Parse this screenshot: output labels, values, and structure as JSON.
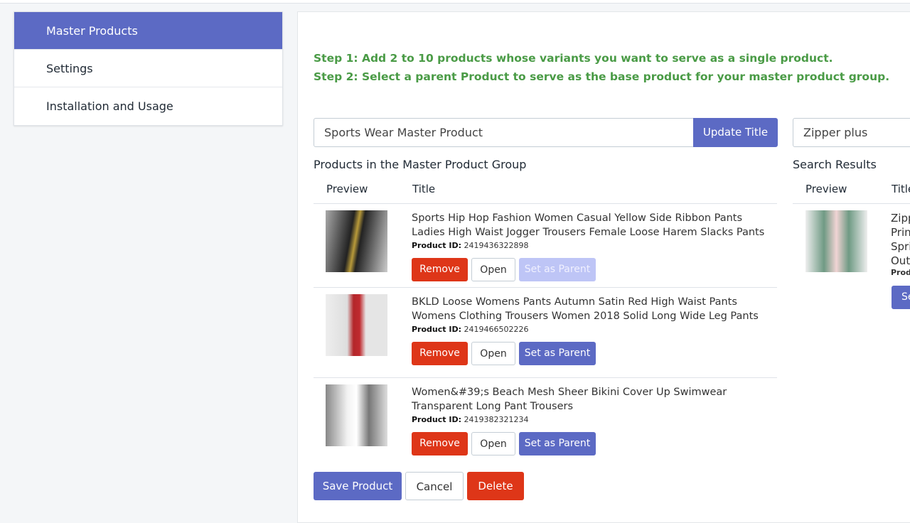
{
  "sidebar": {
    "items": [
      {
        "label": "Master Products",
        "active": true
      },
      {
        "label": "Settings"
      },
      {
        "label": "Installation and Usage"
      }
    ]
  },
  "steps": [
    "Step 1: Add 2 to 10 products whose variants you want to serve as a single product.",
    "Step 2: Select a parent Product to serve as the base product for your master product group."
  ],
  "title_input": {
    "value": "Sports Wear Master Product"
  },
  "update_title_label": "Update Title",
  "search_input": {
    "value": "Zipper plus"
  },
  "group": {
    "heading": "Products in the Master Product Group",
    "columns": [
      "Preview",
      "Title"
    ],
    "product_id_label": "Product ID:",
    "rows": [
      {
        "title": "Sports Hip Hop Fashion Women Casual Yellow Side Ribbon Pants Ladies High Waist Jogger Trousers Female Loose Harem Slacks Pants",
        "id": "2419436322898",
        "parent_disabled": true
      },
      {
        "title": "BKLD Loose Womens Pants Autumn Satin Red High Waist Pants Womens Clothing Trousers Women 2018 Solid Long Wide Leg Pants",
        "id": "2419466502226",
        "parent_disabled": false
      },
      {
        "title": "Women&#39;s Beach Mesh Sheer Bikini Cover Up Swimwear Transparent Long Pant Trousers",
        "id": "2419382321234",
        "parent_disabled": false
      }
    ],
    "remove_label": "Remove",
    "open_label": "Open",
    "parent_label": "Set as Parent"
  },
  "search_results": {
    "heading": "Search Results",
    "columns": [
      "Preview",
      "Title"
    ],
    "row": {
      "lines": [
        "Zipp",
        "Prin",
        "Spri",
        "Out"
      ],
      "id_label": "Prod",
      "button": "Se"
    }
  },
  "footer": {
    "save": "Save Product",
    "cancel": "Cancel",
    "delete": "Delete"
  }
}
